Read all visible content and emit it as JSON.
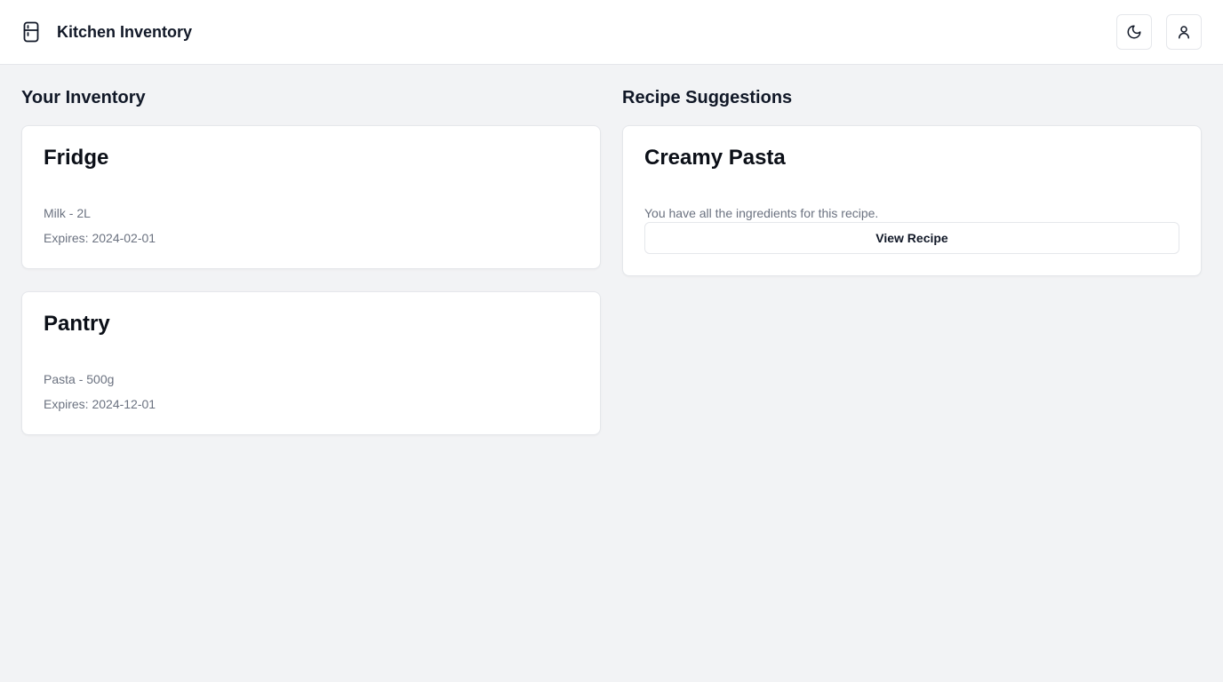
{
  "app": {
    "title": "Kitchen Inventory",
    "icon": "fridge-icon"
  },
  "header_actions": [
    {
      "name": "theme-toggle-button",
      "icon": "moon-icon"
    },
    {
      "name": "profile-button",
      "icon": "user-icon"
    }
  ],
  "inventory": {
    "heading": "Your Inventory",
    "locations": [
      {
        "title": "Fridge",
        "item": "Milk - 2L",
        "expires": "Expires: 2024-02-01"
      },
      {
        "title": "Pantry",
        "item": "Pasta - 500g",
        "expires": "Expires: 2024-12-01"
      }
    ]
  },
  "recipes": {
    "heading": "Recipe Suggestions",
    "items": [
      {
        "title": "Creamy Pasta",
        "description": "You have all the ingredients for this recipe.",
        "button_label": "View Recipe"
      }
    ]
  },
  "colors": {
    "background": "#f2f3f5",
    "surface": "#ffffff",
    "border": "#e5e7eb",
    "text_primary": "#111827",
    "text_muted": "#6b7280"
  }
}
